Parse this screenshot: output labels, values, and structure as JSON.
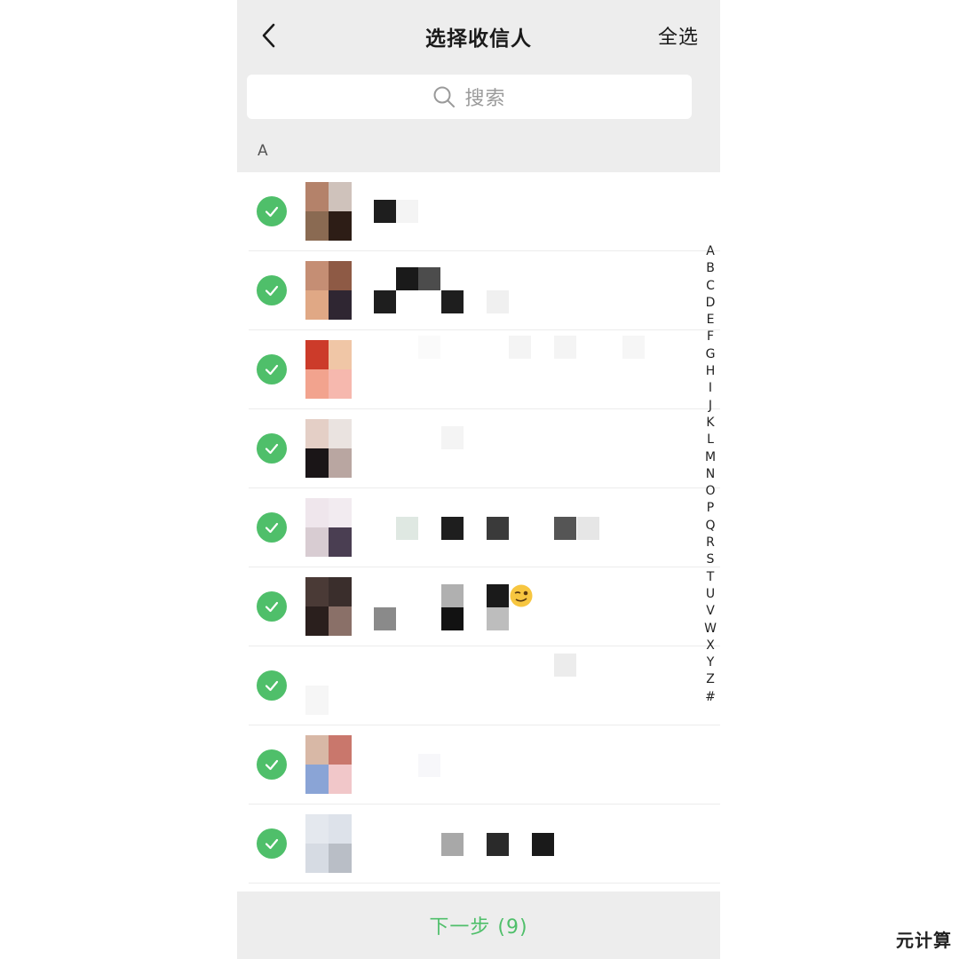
{
  "header": {
    "title": "选择收信人",
    "select_all": "全选",
    "back_icon": "chevron-left-icon"
  },
  "search": {
    "placeholder": "搜索",
    "icon": "search-icon"
  },
  "section": {
    "letter": "A"
  },
  "contacts": [
    {
      "checked": true
    },
    {
      "checked": true
    },
    {
      "checked": true
    },
    {
      "checked": true
    },
    {
      "checked": true
    },
    {
      "checked": true
    },
    {
      "checked": true
    },
    {
      "checked": true
    },
    {
      "checked": true
    }
  ],
  "alphabet": [
    "A",
    "B",
    "C",
    "D",
    "E",
    "F",
    "G",
    "H",
    "I",
    "J",
    "K",
    "L",
    "M",
    "N",
    "O",
    "P",
    "Q",
    "R",
    "S",
    "T",
    "U",
    "V",
    "W",
    "X",
    "Y",
    "Z",
    "#"
  ],
  "footer": {
    "next_label": "下一步 (9)"
  },
  "watermark": "元计算",
  "colors": {
    "accent": "#4fbf6a",
    "bar_background": "#ededed"
  }
}
